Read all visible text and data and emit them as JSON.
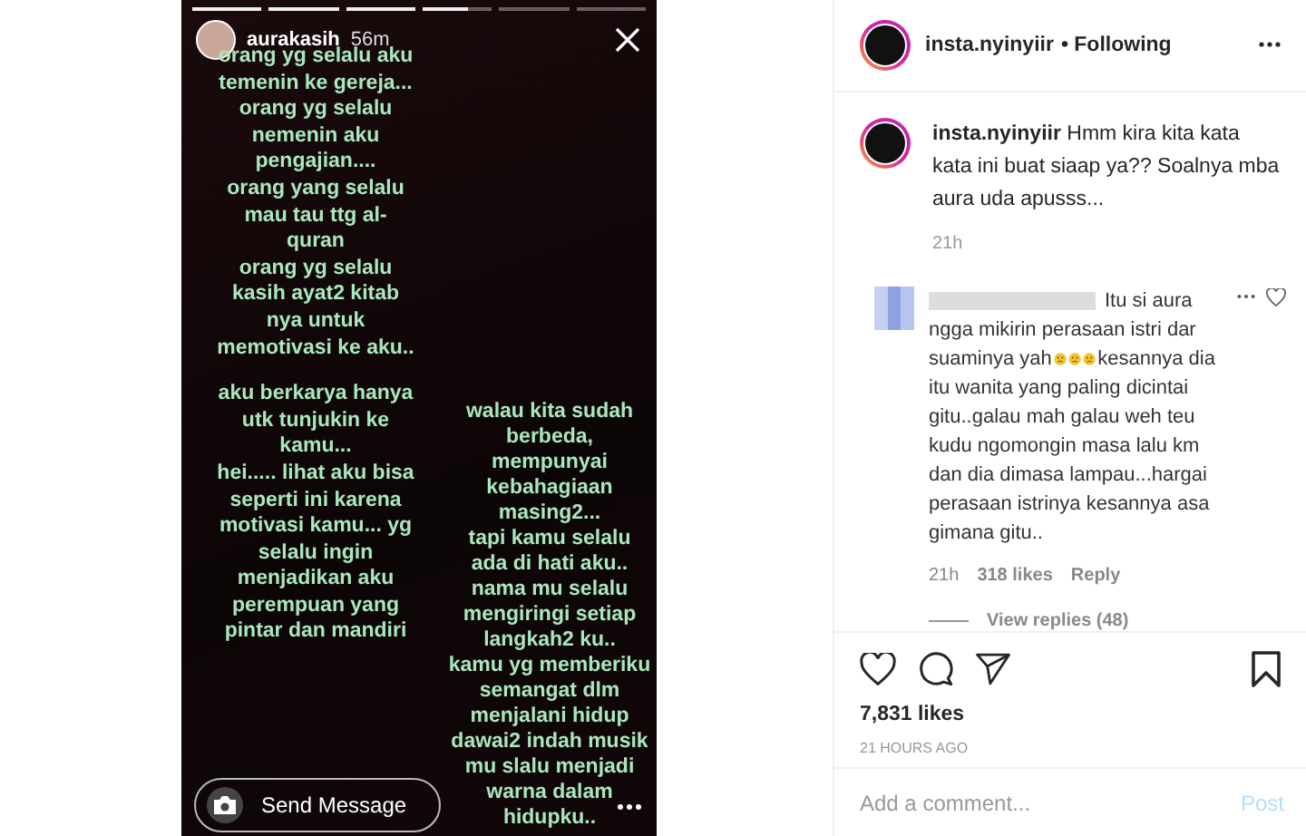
{
  "story": {
    "progress": [
      {
        "level": 1
      },
      {
        "level": 1
      },
      {
        "level": 1
      },
      {
        "level": 0.65
      },
      {
        "level": 0
      },
      {
        "level": 0
      }
    ],
    "username": "aurakasih",
    "time": "56m",
    "column_1": [
      [
        "orang yg selalu aku",
        "temenin ke gereja...",
        "orang yg selalu",
        "nemenin aku",
        "pengajian....",
        "orang yang selalu",
        "mau tau ttg al-",
        "quran",
        "orang yg selalu",
        "kasih ayat2 kitab",
        "nya untuk",
        "memotivasi ke aku.."
      ],
      [
        "aku berkarya hanya",
        "utk tunjukin ke",
        "kamu...",
        "hei..... lihat aku bisa",
        "seperti ini karena",
        "motivasi kamu... yg",
        "selalu ingin",
        "menjadikan aku",
        "perempuan yang",
        "pintar dan mandiri"
      ]
    ],
    "column_2": [
      "walau kita sudah",
      "berbeda,",
      "mempunyai",
      "kebahagiaan",
      "masing2...",
      "tapi kamu selalu",
      "ada di hati aku..",
      "nama mu selalu",
      "mengiringi setiap",
      "langkah2 ku..",
      "kamu yg memberiku",
      "semangat dlm",
      "menjalani hidup",
      "dawai2 indah musik",
      "mu slalu menjadi",
      "warna dalam",
      "hidupku.."
    ],
    "message": {
      "placeholder": "Send Message"
    }
  },
  "post": {
    "username": "insta.nyinyiir",
    "following": "• Following",
    "caption": {
      "username": "insta.nyinyiir",
      "text": "Hmm kira kita kata kata ini buat siaap ya?? Soalnya mba aura uda apusss...",
      "time": "21h"
    },
    "comments": [
      {
        "line_1": "Itu si aura",
        "line_2": "ngga mikirin perasaan istri dar",
        "line_3_start": "suaminya yah",
        "line_3_end": "kesannya dia",
        "rest": "itu wanita yang paling dicintai gitu..galau mah galau weh teu kudu ngomongin masa lalu km dan dia dimasa lampau...hargai perasaan istrinya kesannya asa gimana gitu..",
        "time": "21h",
        "likes": "318 likes",
        "reply": "Reply",
        "liked": false,
        "view_replies": "View replies (48)"
      }
    ],
    "likes": "7,831 likes",
    "posted": "21 HOURS AGO",
    "comment_field": {
      "placeholder": "Add a comment...",
      "button": "Post"
    }
  }
}
